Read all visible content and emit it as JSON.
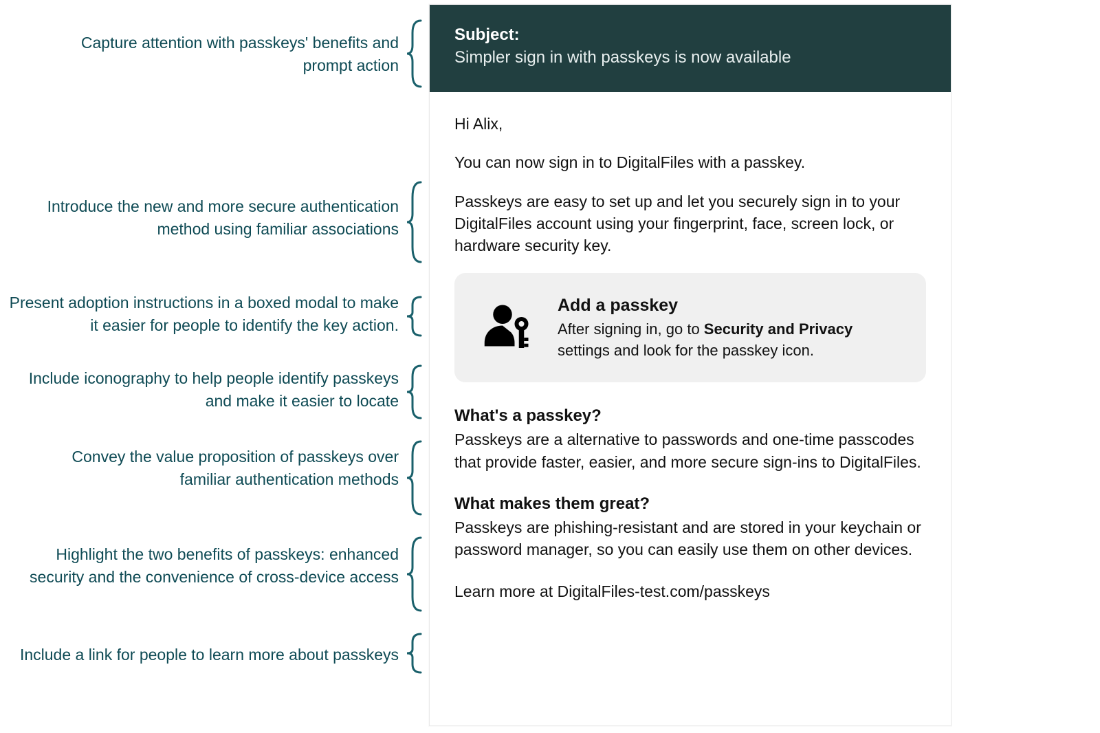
{
  "colors": {
    "annotation": "#0e4a54",
    "header_bg": "#213f40",
    "callout_bg": "#f0f0f0"
  },
  "annotations": [
    "Capture attention with passkeys' benefits and prompt action",
    "Introduce the new and more secure authentication method using familiar associations",
    "Present adoption instructions in a boxed modal to make it easier for people to identify the key action.",
    "Include iconography to help people identify passkeys and make it easier to locate",
    "Convey the value proposition of passkeys over familiar authentication methods",
    "Highlight the two  benefits of passkeys: enhanced security and the convenience of cross-device access",
    "Include a link for people to learn more about passkeys"
  ],
  "email": {
    "subject_label": "Subject:",
    "subject_line": "Simpler sign in with passkeys is now available",
    "greeting": "Hi Alix,",
    "intro": "You can now sign in to DigitalFiles with a passkey.",
    "description": "Passkeys are easy to set up and let you securely sign in to your DigitalFiles account using your fingerprint, face, screen lock, or hardware security key.",
    "callout": {
      "icon_name": "person-passkey-icon",
      "title": "Add a passkey",
      "desc_before": "After signing in, go to ",
      "desc_bold": "Security and Privacy",
      "desc_after": " settings and look for the passkey icon."
    },
    "section1_title": "What's a passkey?",
    "section1_text": "Passkeys are a alternative to passwords and one-time passcodes that provide faster, easier, and more secure sign-ins to DigitalFiles.",
    "section2_title": "What makes them great?",
    "section2_text": "Passkeys are phishing-resistant and are stored in your keychain or password manager, so you can easily use them on other devices.",
    "learn_more_prefix": "Learn more at ",
    "learn_more_url": "DigitalFiles-test.com/passkeys"
  }
}
